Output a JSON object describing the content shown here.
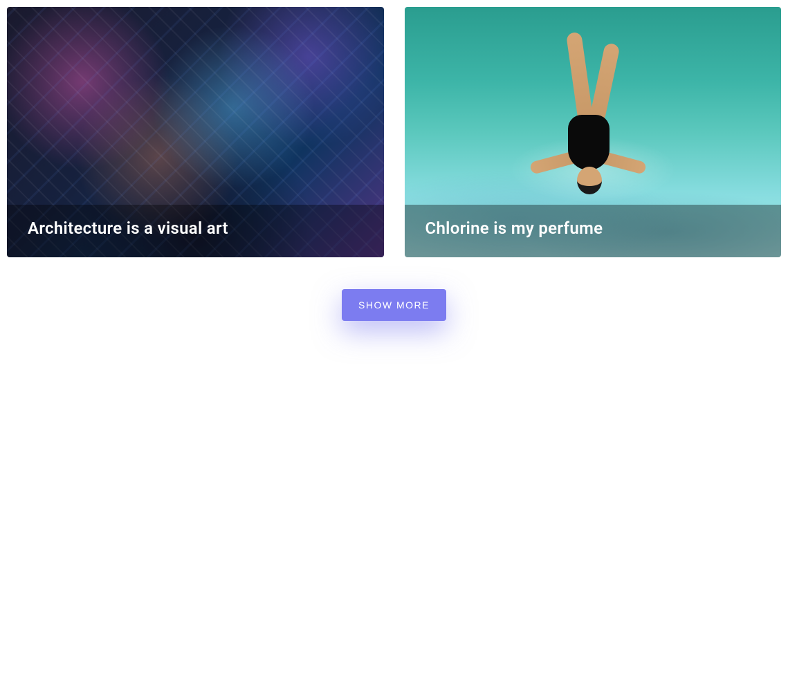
{
  "cards": [
    {
      "title": "Architecture is a visual art"
    },
    {
      "title": "Chlorine is my perfume"
    }
  ],
  "actions": {
    "show_more_label": "SHOW MORE"
  },
  "colors": {
    "accent": "#7c7cf0"
  }
}
